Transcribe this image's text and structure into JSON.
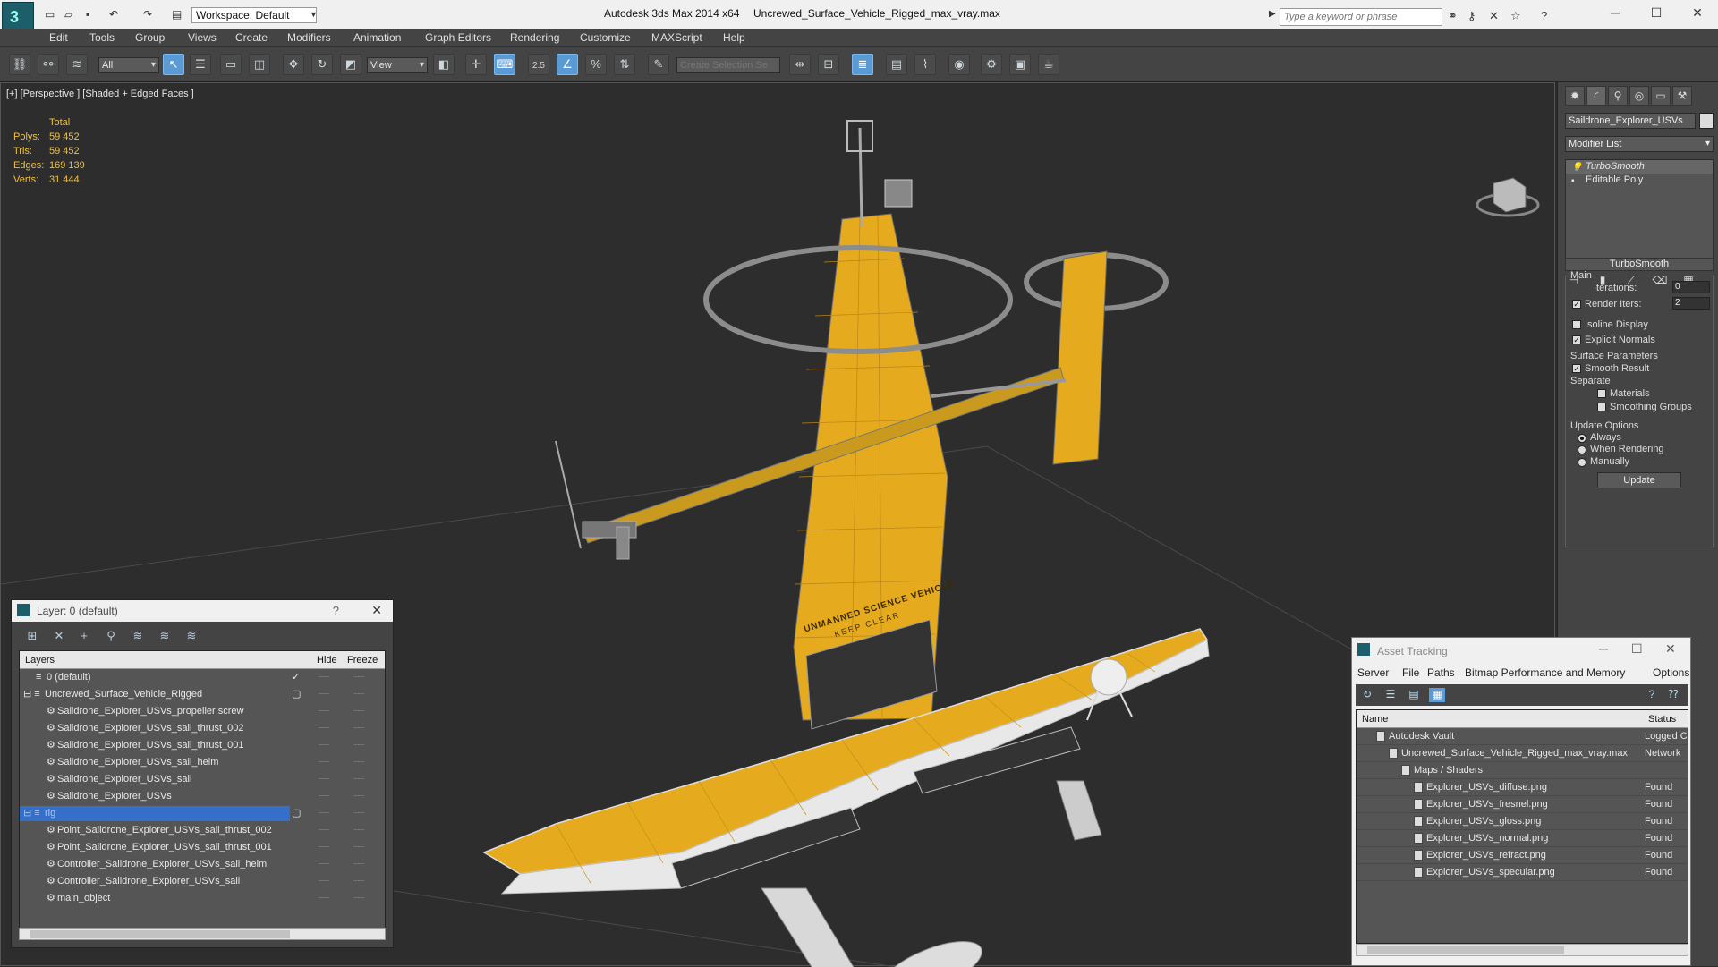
{
  "titlebar": {
    "workspace": "Workspace: Default",
    "app_title": "Autodesk 3ds Max  2014 x64",
    "file_title": "Uncrewed_Surface_Vehicle_Rigged_max_vray.max",
    "search_placeholder": "Type a keyword or phrase"
  },
  "menu": [
    "Edit",
    "Tools",
    "Group",
    "Views",
    "Create",
    "Modifiers",
    "Animation",
    "Graph Editors",
    "Rendering",
    "Customize",
    "MAXScript",
    "Help"
  ],
  "toolbar": {
    "filter_value": "All",
    "ref_coord_value": "View",
    "selection_set_placeholder": "Create Selection Se",
    "snap_label": "2.5"
  },
  "viewport": {
    "label": "[+] [Perspective ] [Shaded + Edged Faces ]",
    "stats": {
      "header": "Total",
      "rows": [
        {
          "label": "Polys:",
          "value": "59 452"
        },
        {
          "label": "Tris:",
          "value": "59 452"
        },
        {
          "label": "Edges:",
          "value": "169 139"
        },
        {
          "label": "Verts:",
          "value": "31 444"
        }
      ]
    },
    "hull_text_1": "UNMANNED SCIENCE VEHICLE",
    "hull_text_2": "KEEP CLEAR",
    "colors": {
      "hull": "#e6aa1e",
      "wire": "#6a6a6a",
      "bg": "#2d2d2d"
    }
  },
  "command_panel": {
    "object_name": "Saildrone_Explorer_USVs",
    "modifier_list": "Modifier List",
    "stack": [
      "TurboSmooth",
      "Editable Poly"
    ],
    "rollout_title": "TurboSmooth",
    "main_label": "Main",
    "iterations_label": "Iterations:",
    "iterations_value": "0",
    "render_iters_label": "Render Iters:",
    "render_iters_value": "2",
    "isoline_label": "Isoline Display",
    "explicit_normals_label": "Explicit Normals",
    "surface_params_label": "Surface Parameters",
    "smooth_result_label": "Smooth Result",
    "separate_label": "Separate",
    "materials_label": "Materials",
    "smoothing_groups_label": "Smoothing Groups",
    "update_options_label": "Update Options",
    "always_label": "Always",
    "when_rendering_label": "When Rendering",
    "manually_label": "Manually",
    "update_button": "Update"
  },
  "layer_dialog": {
    "title": "Layer: 0 (default)",
    "help": "?",
    "columns": {
      "layers": "Layers",
      "hide": "Hide",
      "freeze": "Freeze"
    },
    "rows": [
      {
        "name": "0 (default)",
        "level": 1,
        "current": "✓"
      },
      {
        "name": "Uncrewed_Surface_Vehicle_Rigged",
        "level": 0,
        "current": "▢"
      },
      {
        "name": "Saildrone_Explorer_USVs_propeller screw",
        "level": 2,
        "current": ""
      },
      {
        "name": "Saildrone_Explorer_USVs_sail_thrust_002",
        "level": 2,
        "current": ""
      },
      {
        "name": "Saildrone_Explorer_USVs_sail_thrust_001",
        "level": 2,
        "current": ""
      },
      {
        "name": "Saildrone_Explorer_USVs_sail_helm",
        "level": 2,
        "current": ""
      },
      {
        "name": "Saildrone_Explorer_USVs_sail",
        "level": 2,
        "current": ""
      },
      {
        "name": "Saildrone_Explorer_USVs",
        "level": 2,
        "current": ""
      },
      {
        "name": "rig",
        "level": 0,
        "current": "▢",
        "selected": true
      },
      {
        "name": "Point_Saildrone_Explorer_USVs_sail_thrust_002",
        "level": 2,
        "current": ""
      },
      {
        "name": "Point_Saildrone_Explorer_USVs_sail_thrust_001",
        "level": 2,
        "current": ""
      },
      {
        "name": "Controller_Saildrone_Explorer_USVs_sail_helm",
        "level": 2,
        "current": ""
      },
      {
        "name": "Controller_Saildrone_Explorer_USVs_sail",
        "level": 2,
        "current": ""
      },
      {
        "name": "main_object",
        "level": 2,
        "current": ""
      }
    ]
  },
  "asset_dialog": {
    "title": "Asset Tracking",
    "menu": [
      "Server",
      "File",
      "Paths",
      "Bitmap Performance and Memory",
      "Options"
    ],
    "columns": {
      "name": "Name",
      "status": "Status"
    },
    "rows": [
      {
        "name": "Autodesk Vault",
        "status": "Logged C",
        "level": 1
      },
      {
        "name": "Uncrewed_Surface_Vehicle_Rigged_max_vray.max",
        "status": "Network",
        "level": 2
      },
      {
        "name": "Maps / Shaders",
        "status": "",
        "level": 3
      },
      {
        "name": "Explorer_USVs_diffuse.png",
        "status": "Found",
        "level": 4
      },
      {
        "name": "Explorer_USVs_fresnel.png",
        "status": "Found",
        "level": 4
      },
      {
        "name": "Explorer_USVs_gloss.png",
        "status": "Found",
        "level": 4
      },
      {
        "name": "Explorer_USVs_normal.png",
        "status": "Found",
        "level": 4
      },
      {
        "name": "Explorer_USVs_refract.png",
        "status": "Found",
        "level": 4
      },
      {
        "name": "Explorer_USVs_specular.png",
        "status": "Found",
        "level": 4
      }
    ]
  }
}
